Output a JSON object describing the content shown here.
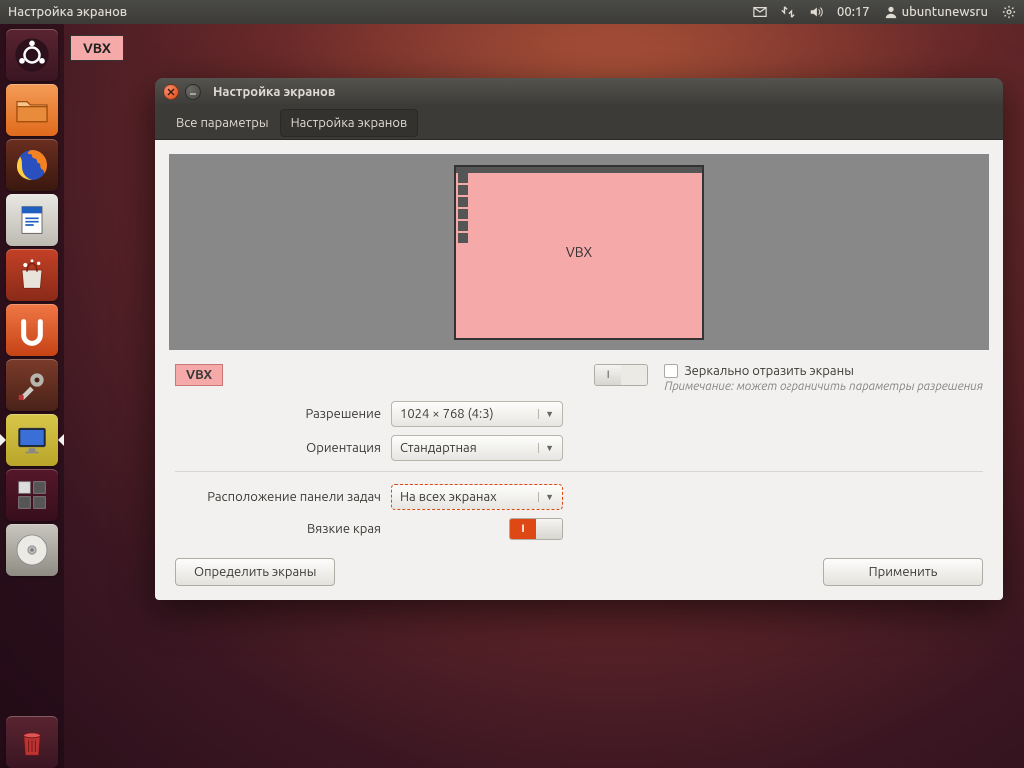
{
  "top_panel": {
    "app_title": "Настройка экранов",
    "clock": "00:17",
    "user": "ubuntunewsru"
  },
  "desk_label": "VBX",
  "window": {
    "title": "Настройка экранов",
    "breadcrumb": {
      "all": "Все параметры",
      "current": "Настройка экранов"
    },
    "monitor_label": "VBX",
    "badge": "VBX",
    "mirror": {
      "label": "Зеркально отразить экраны",
      "note": "Примечание: может ограничить параметры разрешения"
    },
    "resolution": {
      "label": "Разрешение",
      "value": "1024 × 768 (4:3)"
    },
    "orientation": {
      "label": "Ориентация",
      "value": "Стандартная"
    },
    "launcher_placement": {
      "label": "Расположение панели задач",
      "value": "На всех экранах"
    },
    "sticky_edges": {
      "label": "Вязкие края"
    },
    "buttons": {
      "detect": "Определить экраны",
      "apply": "Применить"
    },
    "switch_on_glyph": "I"
  }
}
